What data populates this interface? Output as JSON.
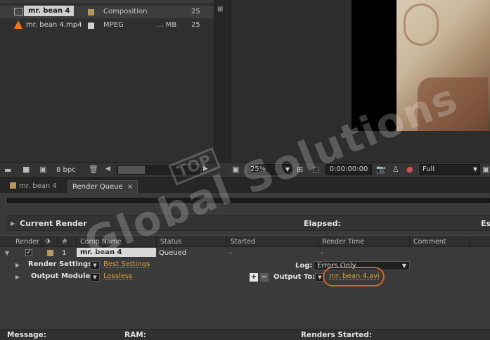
{
  "project": {
    "items": [
      {
        "name": "mr. bean 4",
        "type": "Composition",
        "size": "",
        "frame_rate": "25",
        "label_color": "#b8975a",
        "icon": "composition-icon"
      },
      {
        "name": "mr. bean 4.mp4",
        "type": "MPEG",
        "size": "... MB",
        "frame_rate": "25",
        "label_color": "#cfcfcf",
        "icon": "vlc-cone-icon"
      }
    ],
    "bit_depth": "8 bpc"
  },
  "viewer": {
    "zoom": "25%",
    "timecode": "0:00:00:00",
    "resolution": "Full"
  },
  "tabs": [
    {
      "label": "mr. bean 4",
      "active": false
    },
    {
      "label": "Render Queue",
      "active": true,
      "close": "×"
    }
  ],
  "render_queue": {
    "current_render_label": "Current Render",
    "elapsed_label": "Elapsed:",
    "est_label": "Es",
    "columns": [
      "Render",
      "#",
      "Comp Name",
      "Status",
      "Started",
      "Render Time",
      "Comment"
    ],
    "item": {
      "number": "1",
      "comp_name": "mr. bean 4",
      "status": "Queued",
      "started": "-",
      "render_time": "-",
      "checked": "✓"
    },
    "render_settings_label": "Render Settings:",
    "render_settings_value": "Best Settings",
    "output_module_label": "Output Module:",
    "output_module_value": "Lossless",
    "log_label": "Log:",
    "log_value": "Errors Only",
    "output_to_label": "Output To:",
    "output_to_value": "mr. bean 4.avi"
  },
  "status_bar": {
    "message_label": "Message:",
    "ram_label": "RAM:",
    "renders_started_label": "Renders Started:"
  },
  "watermark": {
    "top": "TOP",
    "text": "Global Solutions"
  }
}
